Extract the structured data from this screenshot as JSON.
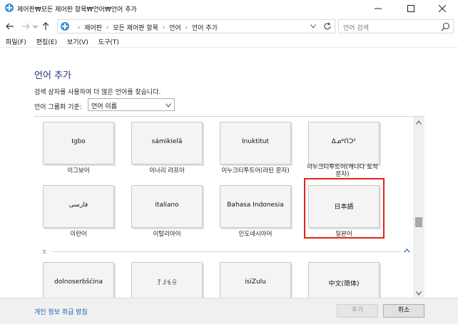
{
  "window": {
    "title": "제어판₩모든 제어판 항목₩언어₩언어 추가"
  },
  "nav": {
    "breadcrumbs": [
      "제어판",
      "모든 제어판 항목",
      "언어",
      "언어 추가"
    ],
    "search_placeholder": "언어 검색"
  },
  "menu": [
    "파일(F)",
    "편집(E)",
    "보기(V)",
    "도구(T)"
  ],
  "page": {
    "title": "언어 추가",
    "description": "검색 상자를 사용하여 더 많은 언어를 찾습니다.",
    "group_label": "언어 그룹화 기준:",
    "group_value": "언어 이름"
  },
  "languages": [
    {
      "native": "Igbo",
      "label": "이그보어"
    },
    {
      "native": "sámikielâ",
      "label": "이나리 라프어"
    },
    {
      "native": "Inuktitut",
      "label": "이누크티투트어(라틴 문자)"
    },
    {
      "native": "ᐃᓄᒃᑎᑐᑦ",
      "label": "이누크티투트어(캐나다 토착 문자)"
    },
    {
      "native": "فارسى",
      "label": "이란어"
    },
    {
      "native": "italiano",
      "label": "이탈리아어"
    },
    {
      "native": "Bahasa Indonesia",
      "label": "인도네시아어"
    },
    {
      "native": "日本語",
      "label": "일본어",
      "selected": true
    },
    {
      "native": "dolnoserbšćina",
      "label": ""
    },
    {
      "native": "ꆈꌠꁱꂷ",
      "label": ""
    },
    {
      "native": "isiZulu",
      "label": ""
    },
    {
      "native": "中文(简体)",
      "label": ""
    }
  ],
  "section": {
    "letter": "ㅈ"
  },
  "footer": {
    "privacy": "개인 정보 취급 방침",
    "add": "추가",
    "cancel": "취소"
  },
  "colors": {
    "accent": "#1e3287",
    "selection": "#e2231a",
    "link": "#1a5fb4"
  }
}
